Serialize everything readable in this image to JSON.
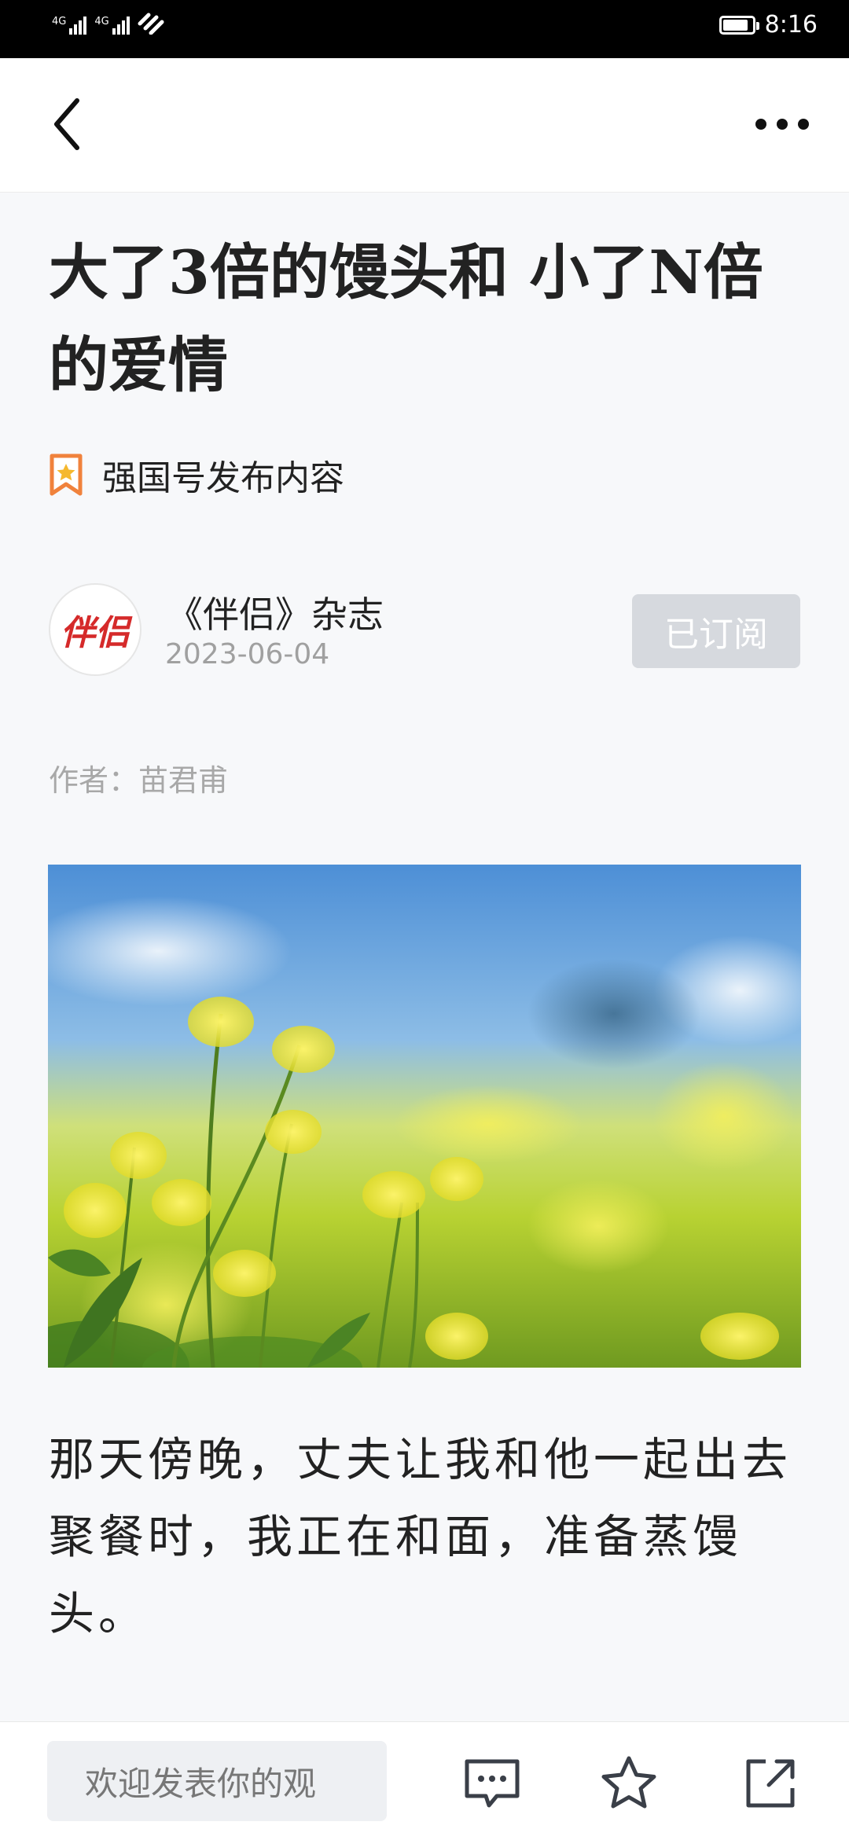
{
  "status_bar": {
    "sim1_label": "4G",
    "sim2_label": "4G",
    "battery_level": 0.85,
    "time": "8:16"
  },
  "nav": {
    "back_icon": "chevron-left-icon",
    "more_icon": "more-horizontal-icon"
  },
  "article": {
    "title": "大了3倍的馒头和 小了N倍的爱情",
    "source_label": "强国号发布内容",
    "publisher": {
      "name": "《伴侣》杂志",
      "logo_text": "伴侣",
      "date": "2023-06-04",
      "subscribe_label": "已订阅"
    },
    "author": "作者：苗君甫",
    "paragraph": "那天傍晚，丈夫让我和他一起出去聚餐时，我正在和面，准备蒸馒头。"
  },
  "bottom_bar": {
    "comment_placeholder": "欢迎发表你的观",
    "comment_icon": "comment-icon",
    "favorite_icon": "star-icon",
    "share_icon": "share-icon"
  },
  "colors": {
    "publisher_logo": "#d52a2a",
    "subscribe_bg": "#d6d9de",
    "source_icon_orange": "#f0823c",
    "page_bg": "#f7f8fa"
  }
}
